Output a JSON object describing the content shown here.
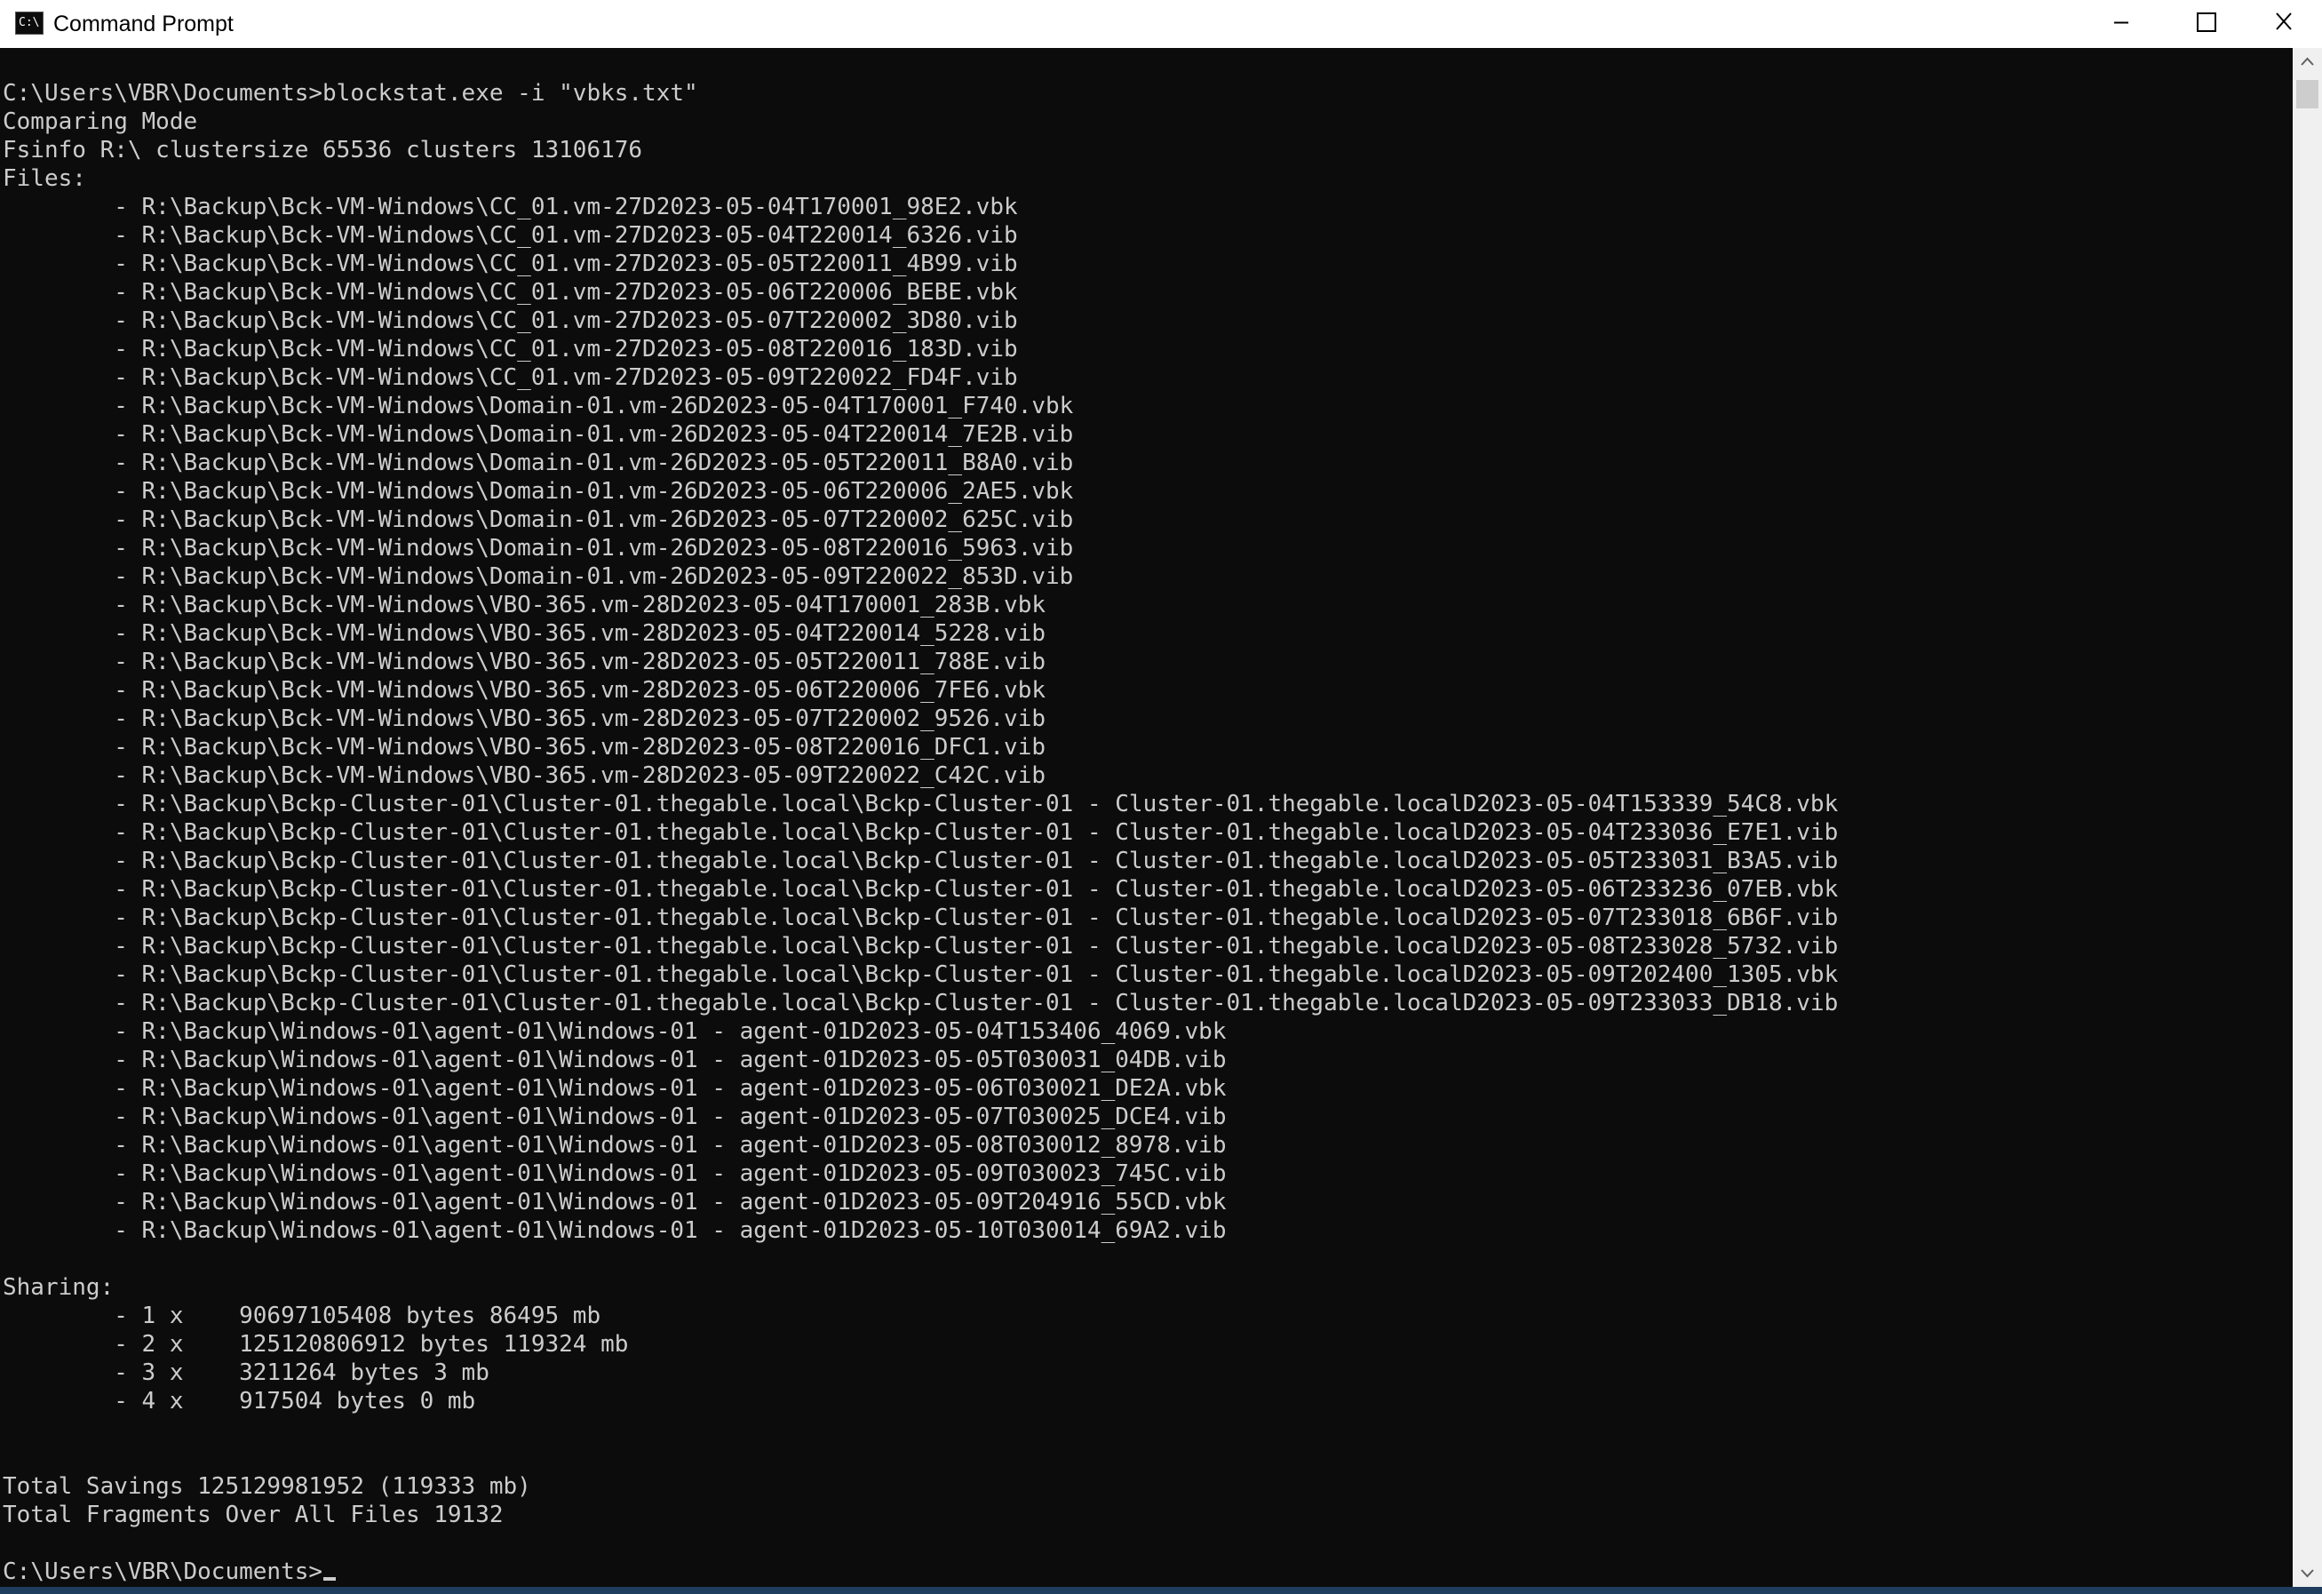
{
  "window": {
    "title": "Command Prompt",
    "app_icon_text": "C:\\",
    "buttons": [
      "minimize-icon",
      "maximize-icon",
      "close-icon"
    ]
  },
  "console": {
    "lines": [
      "C:\\Users\\VBR\\Documents>blockstat.exe -i \"vbks.txt\"",
      "Comparing Mode",
      "Fsinfo R:\\ clustersize 65536 clusters 13106176",
      "Files:",
      "        - R:\\Backup\\Bck-VM-Windows\\CC_01.vm-27D2023-05-04T170001_98E2.vbk",
      "        - R:\\Backup\\Bck-VM-Windows\\CC_01.vm-27D2023-05-04T220014_6326.vib",
      "        - R:\\Backup\\Bck-VM-Windows\\CC_01.vm-27D2023-05-05T220011_4B99.vib",
      "        - R:\\Backup\\Bck-VM-Windows\\CC_01.vm-27D2023-05-06T220006_BEBE.vbk",
      "        - R:\\Backup\\Bck-VM-Windows\\CC_01.vm-27D2023-05-07T220002_3D80.vib",
      "        - R:\\Backup\\Bck-VM-Windows\\CC_01.vm-27D2023-05-08T220016_183D.vib",
      "        - R:\\Backup\\Bck-VM-Windows\\CC_01.vm-27D2023-05-09T220022_FD4F.vib",
      "        - R:\\Backup\\Bck-VM-Windows\\Domain-01.vm-26D2023-05-04T170001_F740.vbk",
      "        - R:\\Backup\\Bck-VM-Windows\\Domain-01.vm-26D2023-05-04T220014_7E2B.vib",
      "        - R:\\Backup\\Bck-VM-Windows\\Domain-01.vm-26D2023-05-05T220011_B8A0.vib",
      "        - R:\\Backup\\Bck-VM-Windows\\Domain-01.vm-26D2023-05-06T220006_2AE5.vbk",
      "        - R:\\Backup\\Bck-VM-Windows\\Domain-01.vm-26D2023-05-07T220002_625C.vib",
      "        - R:\\Backup\\Bck-VM-Windows\\Domain-01.vm-26D2023-05-08T220016_5963.vib",
      "        - R:\\Backup\\Bck-VM-Windows\\Domain-01.vm-26D2023-05-09T220022_853D.vib",
      "        - R:\\Backup\\Bck-VM-Windows\\VBO-365.vm-28D2023-05-04T170001_283B.vbk",
      "        - R:\\Backup\\Bck-VM-Windows\\VBO-365.vm-28D2023-05-04T220014_5228.vib",
      "        - R:\\Backup\\Bck-VM-Windows\\VBO-365.vm-28D2023-05-05T220011_788E.vib",
      "        - R:\\Backup\\Bck-VM-Windows\\VBO-365.vm-28D2023-05-06T220006_7FE6.vbk",
      "        - R:\\Backup\\Bck-VM-Windows\\VBO-365.vm-28D2023-05-07T220002_9526.vib",
      "        - R:\\Backup\\Bck-VM-Windows\\VBO-365.vm-28D2023-05-08T220016_DFC1.vib",
      "        - R:\\Backup\\Bck-VM-Windows\\VBO-365.vm-28D2023-05-09T220022_C42C.vib",
      "        - R:\\Backup\\Bckp-Cluster-01\\Cluster-01.thegable.local\\Bckp-Cluster-01 - Cluster-01.thegable.localD2023-05-04T153339_54C8.vbk",
      "        - R:\\Backup\\Bckp-Cluster-01\\Cluster-01.thegable.local\\Bckp-Cluster-01 - Cluster-01.thegable.localD2023-05-04T233036_E7E1.vib",
      "        - R:\\Backup\\Bckp-Cluster-01\\Cluster-01.thegable.local\\Bckp-Cluster-01 - Cluster-01.thegable.localD2023-05-05T233031_B3A5.vib",
      "        - R:\\Backup\\Bckp-Cluster-01\\Cluster-01.thegable.local\\Bckp-Cluster-01 - Cluster-01.thegable.localD2023-05-06T233236_07EB.vbk",
      "        - R:\\Backup\\Bckp-Cluster-01\\Cluster-01.thegable.local\\Bckp-Cluster-01 - Cluster-01.thegable.localD2023-05-07T233018_6B6F.vib",
      "        - R:\\Backup\\Bckp-Cluster-01\\Cluster-01.thegable.local\\Bckp-Cluster-01 - Cluster-01.thegable.localD2023-05-08T233028_5732.vib",
      "        - R:\\Backup\\Bckp-Cluster-01\\Cluster-01.thegable.local\\Bckp-Cluster-01 - Cluster-01.thegable.localD2023-05-09T202400_1305.vbk",
      "        - R:\\Backup\\Bckp-Cluster-01\\Cluster-01.thegable.local\\Bckp-Cluster-01 - Cluster-01.thegable.localD2023-05-09T233033_DB18.vib",
      "        - R:\\Backup\\Windows-01\\agent-01\\Windows-01 - agent-01D2023-05-04T153406_4069.vbk",
      "        - R:\\Backup\\Windows-01\\agent-01\\Windows-01 - agent-01D2023-05-05T030031_04DB.vib",
      "        - R:\\Backup\\Windows-01\\agent-01\\Windows-01 - agent-01D2023-05-06T030021_DE2A.vbk",
      "        - R:\\Backup\\Windows-01\\agent-01\\Windows-01 - agent-01D2023-05-07T030025_DCE4.vib",
      "        - R:\\Backup\\Windows-01\\agent-01\\Windows-01 - agent-01D2023-05-08T030012_8978.vib",
      "        - R:\\Backup\\Windows-01\\agent-01\\Windows-01 - agent-01D2023-05-09T030023_745C.vib",
      "        - R:\\Backup\\Windows-01\\agent-01\\Windows-01 - agent-01D2023-05-09T204916_55CD.vbk",
      "        - R:\\Backup\\Windows-01\\agent-01\\Windows-01 - agent-01D2023-05-10T030014_69A2.vib",
      "",
      "Sharing:",
      "        - 1 x    90697105408 bytes 86495 mb",
      "        - 2 x    125120806912 bytes 119324 mb",
      "        - 3 x    3211264 bytes 3 mb",
      "        - 4 x    917504 bytes 0 mb",
      "",
      "",
      "Total Savings 125129981952 (119333 mb)",
      "Total Fragments Over All Files 19132",
      ""
    ],
    "prompt": "C:\\Users\\VBR\\Documents>"
  },
  "colors": {
    "console_bg": "#0c0c0c",
    "console_fg": "#cccccc",
    "titlebar_bg": "#ffffff",
    "scrollbar_bg": "#f0f0f0",
    "scrollbar_thumb": "#cdcdcd"
  }
}
